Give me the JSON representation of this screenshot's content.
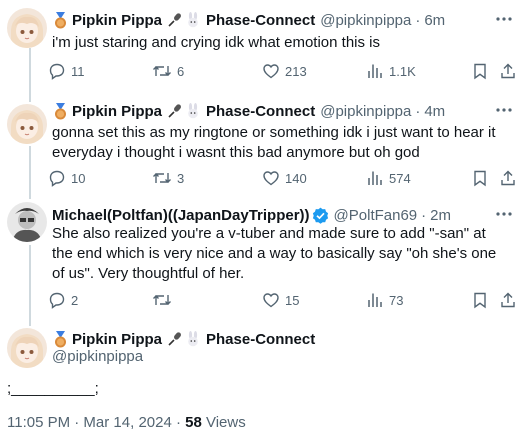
{
  "tweets": [
    {
      "display_name": "Pipkin Pippa",
      "affiliation": "Phase-Connect",
      "handle": "@pipkinpippa",
      "time": "6m",
      "text": "i'm just staring and crying idk what emotion this is",
      "replies": "11",
      "reposts": "6",
      "likes": "213",
      "views": "1.1K"
    },
    {
      "display_name": "Pipkin Pippa",
      "affiliation": "Phase-Connect",
      "handle": "@pipkinpippa",
      "time": "4m",
      "text": "gonna set this as my ringtone or something idk i just want to hear it everyday i thought i wasnt this bad anymore but oh god",
      "replies": "10",
      "reposts": "3",
      "likes": "140",
      "views": "574"
    },
    {
      "display_name": "Michael(Poltfan)((JapanDayTripper))",
      "handle": "@PoltFan69",
      "time": "2m",
      "text": "She also realized you're a v-tuber and made sure to add \"-san\" at the end which is very nice and a way to basically say \"oh she's one of us\". Very thoughtful of her.",
      "replies": "2",
      "likes": "15",
      "views": "73"
    }
  ],
  "main_tweet": {
    "display_name": "Pipkin Pippa",
    "affiliation": "Phase-Connect",
    "handle": "@pipkinpippa",
    "text": ";__________;",
    "timestamp": "11:05 PM · Mar 14, 2024 · ",
    "views_count": "58",
    "views_label": " Views"
  },
  "separator": "·",
  "colors": {
    "text": "#0f1419",
    "muted": "#536471",
    "verified": "#1d9bf0",
    "thread_line": "#cfd9de"
  },
  "icons": [
    "reply-icon",
    "repost-icon",
    "like-icon",
    "views-icon",
    "bookmark-icon",
    "share-icon",
    "more-icon",
    "verified-icon",
    "medal-icon",
    "microphone-icon",
    "rabbit-icon"
  ]
}
